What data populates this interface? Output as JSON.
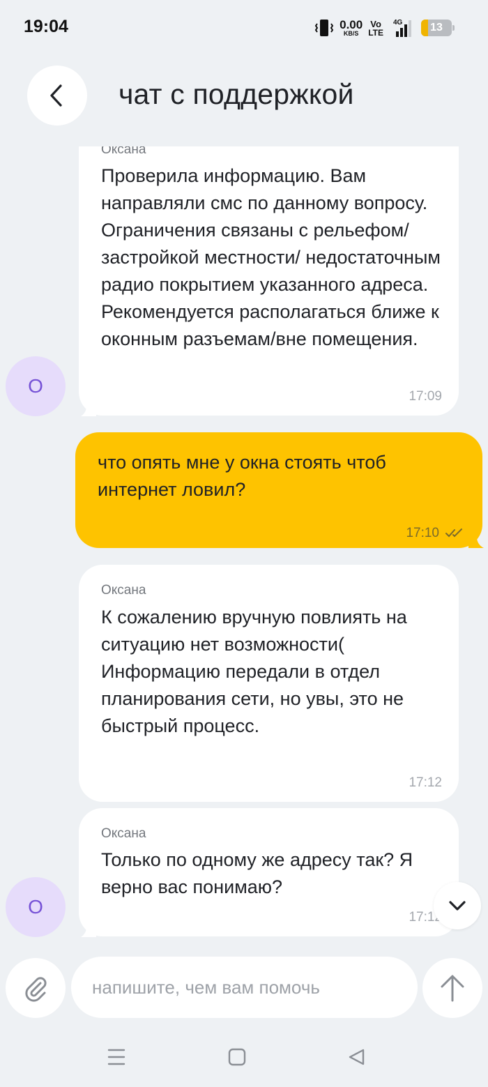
{
  "status_bar": {
    "time": "19:04",
    "net_speed_value": "0.00",
    "net_speed_unit": "KB/S",
    "volte_top": "Vo",
    "volte_bottom": "LTE",
    "network_type": "4G",
    "battery_level": "13"
  },
  "header": {
    "title": "чат с поддержкой"
  },
  "messages": [
    {
      "direction": "in",
      "sender": "Оксана",
      "text": "Проверила информацию. Вам направляли смс по данному вопросу. Ограничения связаны с рельефом/застройкой местности/ недостаточным радио покрытием указанного адреса. Рекомендуется располагаться ближе к оконным разъемам/вне помещения.",
      "time": "17:09",
      "avatar": "О"
    },
    {
      "direction": "out",
      "text": "что опять мне у окна стоять чтоб интернет ловил?",
      "time": "17:10"
    },
    {
      "direction": "in",
      "sender": "Оксана",
      "text": "К сожалению вручную повлиять на ситуацию нет возможности( Информацию передали в отдел планирования сети, но увы, это не быстрый процесс.",
      "time": "17:12"
    },
    {
      "direction": "in",
      "sender": "Оксана",
      "text": "Только по одному же адресу так? Я верно вас понимаю?",
      "time": "17:12",
      "avatar": "О"
    }
  ],
  "composer": {
    "placeholder": "напишите, чем вам помочь",
    "value": ""
  },
  "colors": {
    "background": "#eef1f4",
    "incoming_bubble": "#ffffff",
    "outgoing_bubble": "#fec300",
    "avatar_bg": "#e6dcfb",
    "avatar_text": "#7652d6"
  }
}
